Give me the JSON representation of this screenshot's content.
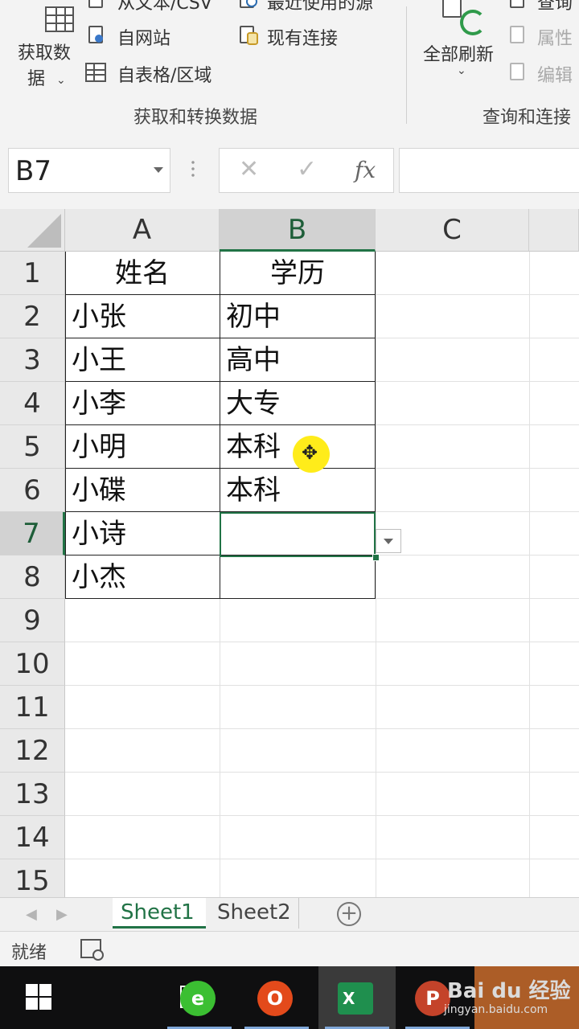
{
  "ribbon": {
    "get_data_label_line1": "获取数",
    "get_data_label_line2": "据",
    "from_text_csv": "从文本/CSV",
    "recent_sources": "最近使用的源",
    "from_web": "自网站",
    "existing_connections": "现有连接",
    "from_table_range": "自表格/区域",
    "group_get_transform": "获取和转换数据",
    "refresh_all": "全部刷新",
    "queries": "查询",
    "properties": "属性",
    "edit_links": "编辑",
    "group_queries_connections": "查询和连接"
  },
  "formula_bar": {
    "name_box": "B7",
    "cancel_glyph": "✕",
    "enter_glyph": "✓",
    "fx": "fx",
    "content": ""
  },
  "grid": {
    "columns": [
      "A",
      "B",
      "C"
    ],
    "selected_column": "B",
    "rows": [
      "1",
      "2",
      "3",
      "4",
      "5",
      "6",
      "7",
      "8",
      "9",
      "10",
      "11",
      "12",
      "13",
      "14",
      "15"
    ],
    "selected_row": "7",
    "header": {
      "A": "姓名",
      "B": "学历"
    },
    "data": [
      {
        "A": "小张",
        "B": "初中"
      },
      {
        "A": "小王",
        "B": "高中"
      },
      {
        "A": "小李",
        "B": "大专"
      },
      {
        "A": "小明",
        "B": "本科"
      },
      {
        "A": "小碟",
        "B": "本科"
      },
      {
        "A": "小诗",
        "B": ""
      },
      {
        "A": "小杰",
        "B": ""
      }
    ],
    "cursor_glyph": "✥"
  },
  "sheets": {
    "tabs": [
      "Sheet1",
      "Sheet2"
    ],
    "active": "Sheet1",
    "add_glyph": "+"
  },
  "status": {
    "ready": "就绪"
  },
  "taskbar": {
    "office_letter": "O",
    "excel_letter": "X",
    "ppt_letter": "P",
    "watermark_line1": "Bai du 经验",
    "watermark_line2": "jingyan.baidu.com"
  },
  "colors": {
    "excel_green": "#217346",
    "ribbon_bg": "#f3f3f3",
    "header_bg": "#e9e9e9",
    "cursor_highlight": "#ffec1a"
  }
}
